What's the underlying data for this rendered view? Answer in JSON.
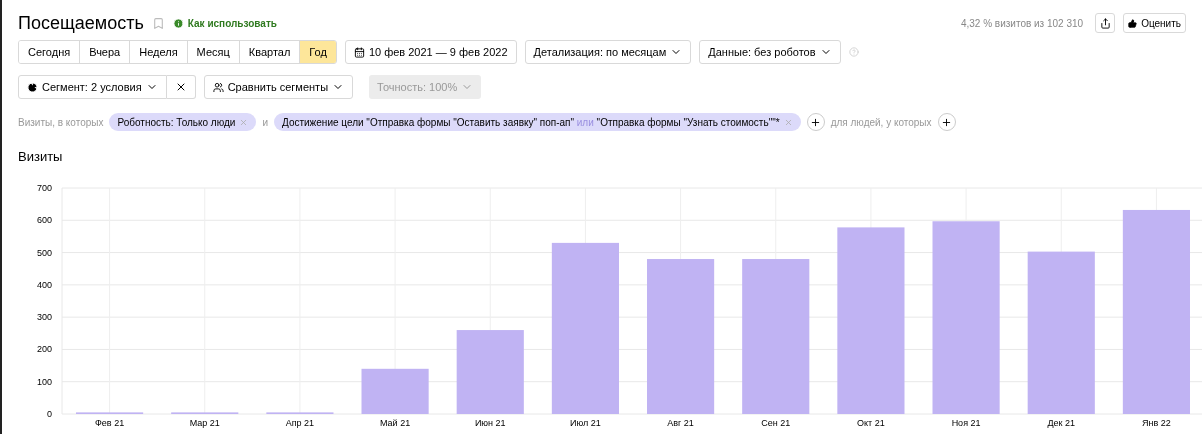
{
  "header": {
    "title": "Посещаемость",
    "help_link": "Как использовать",
    "sample_info": "4,32 % визитов из 102 310",
    "rate_button": "Оценить"
  },
  "periods": [
    {
      "label": "Сегодня",
      "selected": false
    },
    {
      "label": "Вчера",
      "selected": false
    },
    {
      "label": "Неделя",
      "selected": false
    },
    {
      "label": "Месяц",
      "selected": false
    },
    {
      "label": "Квартал",
      "selected": false
    },
    {
      "label": "Год",
      "selected": true
    }
  ],
  "date_range": "10 фев 2021 — 9 фев 2022",
  "detail_dropdown": "Детализация: по месяцам",
  "data_dropdown": "Данные: без роботов",
  "segment_dropdown": "Сегмент: 2 условия",
  "compare_dropdown": "Сравнить сегменты",
  "accuracy_dropdown": {
    "label": "Точность: 100%",
    "disabled": true
  },
  "filters": {
    "prefix": "Визиты, в которых",
    "conditions": [
      {
        "text": "Роботность: Только люди"
      },
      {
        "text": "Достижение цели \"Отправка формы \"Оставить заявку\" поп-ап\" **или** \"Отправка формы \"Узнать стоимость\"\"*"
      }
    ],
    "joiner": "и",
    "people_label": "для людей, у которых"
  },
  "chart_data": {
    "type": "bar",
    "categories": [
      "Фев 21",
      "Мар 21",
      "Апр 21",
      "Май 21",
      "Июн 21",
      "Июл 21",
      "Авг 21",
      "Сен 21",
      "Окт 21",
      "Ноя 21",
      "Дек 21",
      "Янв 22"
    ],
    "series": [
      {
        "name": "Визиты",
        "color": "#c0b3f3",
        "values": [
          5,
          5,
          5,
          140,
          260,
          530,
          480,
          480,
          578,
          597,
          503,
          632
        ]
      }
    ],
    "ylim": [
      0,
      700
    ],
    "grid": true,
    "yticks": [
      0,
      100,
      200,
      300,
      400,
      500,
      600,
      700
    ]
  }
}
